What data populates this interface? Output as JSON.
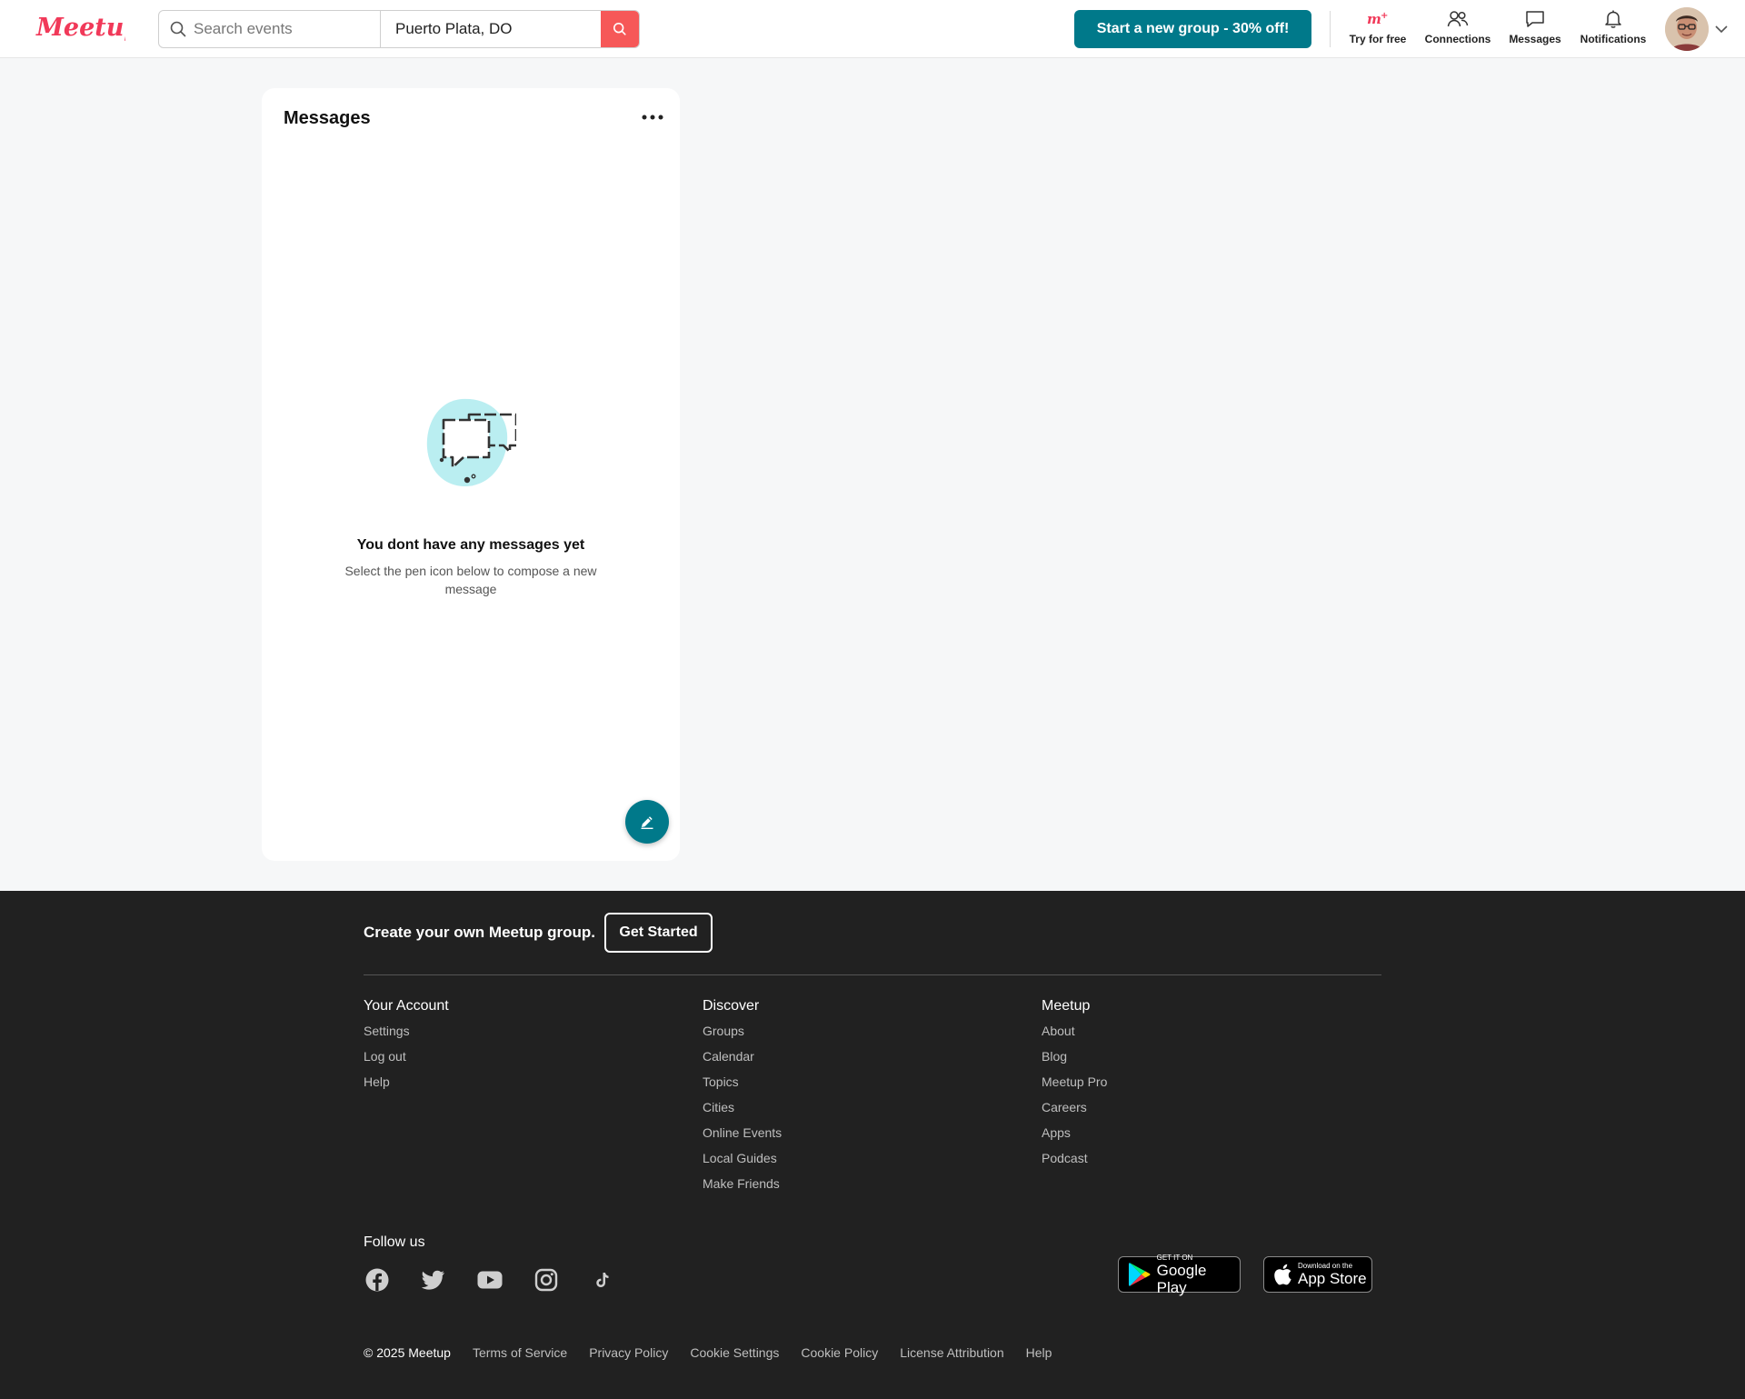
{
  "header": {
    "logo_text": "Meetup",
    "search_placeholder": "Search events",
    "location_value": "Puerto Plata, DO",
    "cta_label": "Start a new group - 30% off!",
    "nav": {
      "try_free": "Try for free",
      "connections": "Connections",
      "messages": "Messages",
      "notifications": "Notifications"
    }
  },
  "messages_panel": {
    "title": "Messages",
    "empty_title": "You dont have any messages yet",
    "empty_subtitle": "Select the pen icon below to compose a new message"
  },
  "footer": {
    "create_text": "Create your own Meetup group.",
    "get_started": "Get Started",
    "columns": [
      {
        "title": "Your Account",
        "links": [
          "Settings",
          "Log out",
          "Help"
        ]
      },
      {
        "title": "Discover",
        "links": [
          "Groups",
          "Calendar",
          "Topics",
          "Cities",
          "Online Events",
          "Local Guides",
          "Make Friends"
        ]
      },
      {
        "title": "Meetup",
        "links": [
          "About",
          "Blog",
          "Meetup Pro",
          "Careers",
          "Apps",
          "Podcast"
        ]
      }
    ],
    "follow_us": "Follow us",
    "social_icons": [
      "facebook-icon",
      "twitter-icon",
      "youtube-icon",
      "instagram-icon",
      "tiktok-icon"
    ],
    "google_play": {
      "small": "GET IT ON",
      "big": "Google Play"
    },
    "app_store": {
      "small": "Download on the",
      "big": "App Store"
    },
    "copyright": "© 2025 Meetup",
    "legal_links": [
      "Terms of Service",
      "Privacy Policy",
      "Cookie Settings",
      "Cookie Policy",
      "License Attribution",
      "Help"
    ]
  },
  "colors": {
    "brand_red": "#f65858",
    "brand_teal": "#00798a",
    "footer_bg": "#212121",
    "page_bg": "#f6f7f8"
  }
}
